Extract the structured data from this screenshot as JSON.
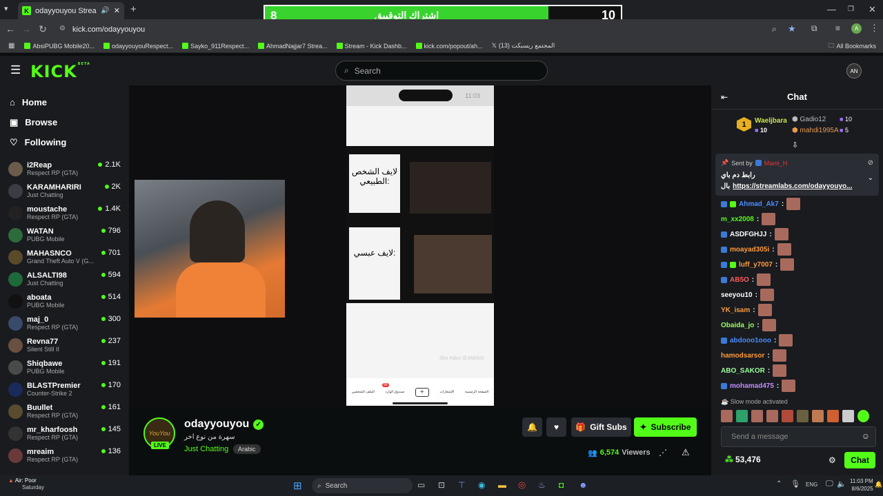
{
  "browser": {
    "tab_title": "odayyouyou Stream - Watch",
    "url": "kick.com/odayyouyou",
    "bookmarks": [
      "AbsiPUBG Mobile20...",
      "odayyouyouRespect...",
      "Sayko_911Respect...",
      "AhmadNajjar7 Strea...",
      "Stream - Kick Dashb...",
      "kick.com/popout/ah...",
      "المجتمع ريسبكت (13)"
    ],
    "all_bookmarks": "All Bookmarks"
  },
  "poll": {
    "left_count": "8",
    "label": "اشتراك التوقييق",
    "right_count": "10"
  },
  "header": {
    "logo": "KICK",
    "beta": "BETA",
    "search_placeholder": "Search",
    "avatar": "AN"
  },
  "nav": [
    {
      "label": "Home",
      "icon": "home-icon"
    },
    {
      "label": "Browse",
      "icon": "browse-icon"
    },
    {
      "label": "Following",
      "icon": "heart-icon"
    }
  ],
  "channels": [
    {
      "name": "i2Reap",
      "category": "Respect RP (GTA)",
      "viewers": "2.1K",
      "color": "#6b5b4b"
    },
    {
      "name": "KARAMHARIRI",
      "category": "Just Chatting",
      "viewers": "2K",
      "color": "#3a3d44"
    },
    {
      "name": "moustache",
      "category": "Respect RP (GTA)",
      "viewers": "1.4K",
      "color": "#222"
    },
    {
      "name": "WATAN",
      "category": "PUBG Mobile",
      "viewers": "796",
      "color": "#2e6b3a"
    },
    {
      "name": "MAHASNCO",
      "category": "Grand Theft Auto V (G...",
      "viewers": "701",
      "color": "#5a4a2a"
    },
    {
      "name": "ALSALTI98",
      "category": "Just Chatting",
      "viewers": "594",
      "color": "#1f6a3a"
    },
    {
      "name": "aboata",
      "category": "PUBG Mobile",
      "viewers": "514",
      "color": "#111"
    },
    {
      "name": "maj_0",
      "category": "Respect RP (GTA)",
      "viewers": "300",
      "color": "#3a4a6a"
    },
    {
      "name": "Revna77",
      "category": "Silent Still II",
      "viewers": "237",
      "color": "#6a5040"
    },
    {
      "name": "Shiqbawe",
      "category": "PUBG Mobile",
      "viewers": "191",
      "color": "#4a4a4a"
    },
    {
      "name": "BLASTPremier",
      "category": "Counter-Strike 2",
      "viewers": "170",
      "color": "#1a2a5a"
    },
    {
      "name": "Buullet",
      "category": "Respect RP (GTA)",
      "viewers": "161",
      "color": "#5a4a30"
    },
    {
      "name": "mr_kharfoosh",
      "category": "Respect RP (GTA)",
      "viewers": "145",
      "color": "#333"
    },
    {
      "name": "mreaim",
      "category": "Respect RP (GTA)",
      "viewers": "136",
      "color": "#6a3a3a"
    }
  ],
  "phone": {
    "time": "11:03",
    "panel1": "لايف الشخص الطبيعي:",
    "panel2": "لايف عبسي:",
    "tag": "3bsi #absi @3ABSI9",
    "nav": [
      "الصفحة الرئيسية",
      "الإشعارات",
      "",
      "صندوق الوارد",
      "الملف الشخصي"
    ],
    "inbox_count": "99"
  },
  "streamer": {
    "name": "odayyouyou",
    "title": "سهرة من نوع اخر",
    "category": "Just Chatting",
    "language": "Arabic",
    "live": "LIVE",
    "viewers": "6,574",
    "viewers_label": "Viewers"
  },
  "actions": {
    "gift": "Gift Subs",
    "subscribe": "Subscribe"
  },
  "chat": {
    "title": "Chat",
    "top": [
      {
        "rank": "1",
        "name": "Waeljbara",
        "count": "10"
      },
      {
        "name": "Gadio12",
        "count": "10"
      },
      {
        "name": "mahdi1995A",
        "count": "5"
      }
    ],
    "pinned": {
      "sent_by": "Sent by",
      "by_name": "Mami_H",
      "line1": "رابط دم باي",
      "line2": "بال",
      "link": "https://streamlabs.com/odayyouyo..."
    },
    "messages": [
      {
        "name": "Ahmad_Ak7",
        "color": "#4a8cff"
      },
      {
        "name": "m_xx2008",
        "color": "#53fc18"
      },
      {
        "name": "ASDFGHJJ",
        "color": "#ffffff"
      },
      {
        "name": "moayad305i",
        "color": "#ff9a3c"
      },
      {
        "name": "luff_y7007",
        "color": "#ff9a3c"
      },
      {
        "name": "AB5O",
        "color": "#ff5a5a"
      },
      {
        "name": "seeyou10",
        "color": "#ffffff"
      },
      {
        "name": "YK_isam",
        "color": "#ff9a3c"
      },
      {
        "name": "Obaida_jo",
        "color": "#9aff5a"
      },
      {
        "name": "abdooo1ooo",
        "color": "#4a8cff"
      },
      {
        "name": "hamodsarsor",
        "color": "#ff9a3c"
      },
      {
        "name": "ABO_SAKOR",
        "color": "#9aff9a"
      },
      {
        "name": "mohamad475",
        "color": "#c58cff"
      }
    ],
    "slow_mode": "Slow mode activated",
    "input_placeholder": "Send a message",
    "points": "53,476",
    "send": "Chat"
  },
  "taskbar": {
    "weather": "Air: Poor",
    "day": "Saturday",
    "search": "Search",
    "lang": "ENG",
    "time": "11:03 PM",
    "date": "8/6/2025"
  }
}
